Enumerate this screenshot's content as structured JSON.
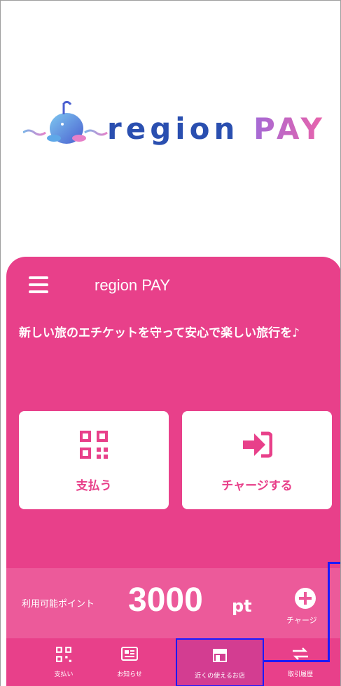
{
  "logo": {
    "word1": "region",
    "word2": "PAY"
  },
  "header": {
    "title": "region PAY"
  },
  "tagline": "新しい旅のエチケットを守って安心で楽しい旅行を♪",
  "actions": {
    "pay_label": "支払う",
    "charge_label": "チャージする"
  },
  "points": {
    "label": "利用可能ポイント",
    "value": "3000",
    "unit": "pt",
    "charge_label": "チャージ"
  },
  "nav": [
    {
      "label": "支払い"
    },
    {
      "label": "お知らせ"
    },
    {
      "label": "近くの使えるお店"
    },
    {
      "label": "取引履歴"
    }
  ],
  "colors": {
    "primary": "#e8408a",
    "points_bg": "#ec5a9a",
    "highlight": "#1a1aff"
  }
}
